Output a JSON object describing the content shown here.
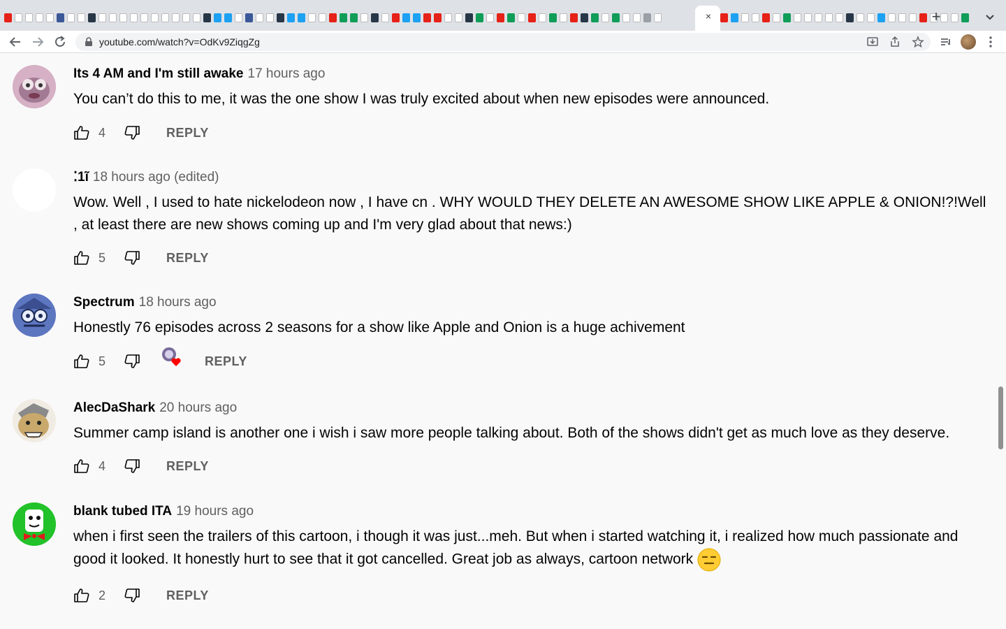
{
  "browser": {
    "url": "youtube.com/watch?v=OdKv9ZiqgZg",
    "tab_close_glyph": "×",
    "new_tab_glyph": "+",
    "favicon_pattern": [
      "red",
      "white",
      "white",
      "white",
      "white",
      "navy",
      "white",
      "white",
      "dark",
      "white",
      "white",
      "white",
      "white",
      "white",
      "white",
      "white",
      "white",
      "white",
      "white",
      "dark",
      "blue",
      "blue",
      "white",
      "navy",
      "white",
      "white",
      "dark",
      "blue",
      "blue",
      "white",
      "white",
      "red",
      "green",
      "green",
      "white",
      "dark",
      "white",
      "red",
      "blue",
      "blue",
      "red",
      "red",
      "white",
      "white",
      "dark",
      "green",
      "white",
      "red",
      "green",
      "white",
      "red",
      "white",
      "green",
      "white",
      "red",
      "dark",
      "green",
      "white",
      "green",
      "white",
      "white",
      "gray",
      "white"
    ],
    "favicon_pattern_right": [
      "red",
      "blue",
      "white",
      "white",
      "red",
      "white",
      "green",
      "white",
      "white",
      "white",
      "white",
      "white",
      "dark",
      "white",
      "white",
      "blue",
      "white",
      "white",
      "white",
      "red",
      "white",
      "white",
      "white",
      "green"
    ]
  },
  "comments": [
    {
      "author": "Its 4 AM and I'm still awake",
      "time": "17 hours ago",
      "text": "You can’t do this to me, it was the one show I was truly excited about when new episodes were announced.",
      "likes": "4",
      "reply": "REPLY",
      "avatar_color": "#c9a0b8"
    },
    {
      "author": "⁚1ĩ",
      "time": "18 hours ago (edited)",
      "text": "Wow. Well , I used to hate nickelodeon now , I have cn . WHY WOULD THEY DELETE AN AWESOME SHOW LIKE APPLE & ONION!?!Well , at least there are new shows coming up and I'm very glad about that news:)",
      "likes": "5",
      "reply": "REPLY",
      "avatar_color": "#ffffff"
    },
    {
      "author": "Spectrum",
      "time": "18 hours ago",
      "text": "Honestly 76 episodes across 2 seasons for a show like Apple and Onion is a huge achivement",
      "likes": "5",
      "reply": "REPLY",
      "avatar_color": "#6a82c8"
    },
    {
      "author": "AlecDaShark",
      "time": "20 hours ago",
      "text": "Summer camp island is another one i wish i saw more people talking about. Both of the shows didn't get as much love as they deserve.",
      "likes": "4",
      "reply": "REPLY",
      "avatar_color": "#c9a86c"
    },
    {
      "author": "blank tubed ITA",
      "time": "19 hours ago",
      "text": "when i first seen the trailers of this cartoon, i though it was just...meh. But when i started watching it, i realized how much passionate and good it looked. It honestly hurt to see that it got cancelled. Great job as always, cartoon network",
      "likes": "2",
      "reply": "REPLY",
      "avatar_color": "#22c22a"
    }
  ],
  "colors": {
    "text": "#030303",
    "secondary": "#606060",
    "heart": "#ff0000",
    "emoji": "#ffcc33"
  }
}
